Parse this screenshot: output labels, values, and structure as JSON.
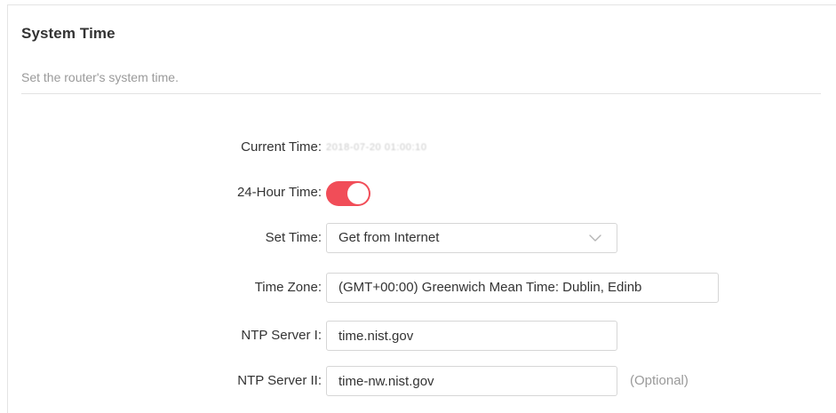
{
  "section": {
    "title": "System Time",
    "description": "Set the router's system time."
  },
  "form": {
    "current_time": {
      "label": "Current Time:",
      "value": "2018-07-20 01:00:10"
    },
    "hour24": {
      "label": "24-Hour Time:",
      "enabled": true,
      "on_color": "#f14d58"
    },
    "set_time": {
      "label": "Set Time:",
      "selected": "Get from Internet"
    },
    "time_zone": {
      "label": "Time Zone:",
      "selected": "(GMT+00:00) Greenwich Mean Time: Dublin, Edinb"
    },
    "ntp1": {
      "label": "NTP Server I:",
      "value": "time.nist.gov"
    },
    "ntp2": {
      "label": "NTP Server II:",
      "value": "time-nw.nist.gov",
      "hint": "(Optional)"
    }
  }
}
